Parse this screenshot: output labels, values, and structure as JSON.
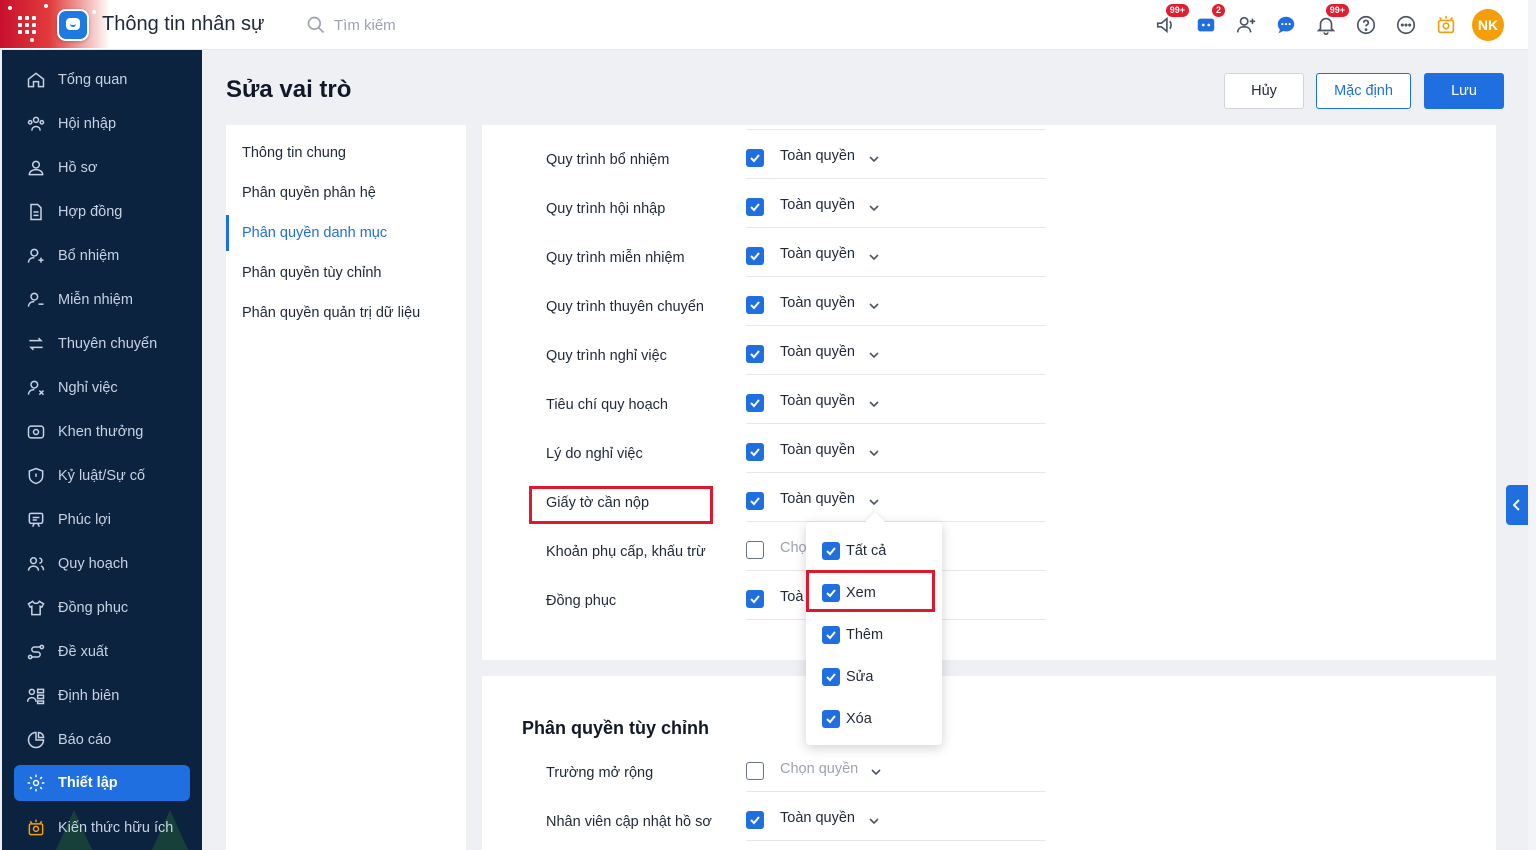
{
  "app": {
    "title": "Thông tin nhân sự",
    "search_placeholder": "Tìm kiếm"
  },
  "topbar": {
    "icons": [
      {
        "name": "megaphone-icon",
        "badge": "99+"
      },
      {
        "name": "cart-icon",
        "badge": "2"
      },
      {
        "name": "add-user-icon",
        "badge": ""
      },
      {
        "name": "chat-icon",
        "badge": ""
      },
      {
        "name": "bell-icon",
        "badge": "99+"
      },
      {
        "name": "help-icon",
        "badge": ""
      },
      {
        "name": "more-icon",
        "badge": ""
      },
      {
        "name": "idea-icon",
        "badge": ""
      }
    ],
    "avatar": "NK"
  },
  "sidebar": {
    "items": [
      {
        "label": "Tổng quan",
        "icon": "home-icon"
      },
      {
        "label": "Hội nhập",
        "icon": "team-icon"
      },
      {
        "label": "Hồ sơ",
        "icon": "user-icon"
      },
      {
        "label": "Hợp đồng",
        "icon": "document-icon"
      },
      {
        "label": "Bổ nhiệm",
        "icon": "user-plus-icon"
      },
      {
        "label": "Miễn nhiệm",
        "icon": "user-minus-icon"
      },
      {
        "label": "Thuyên chuyển",
        "icon": "transfer-icon"
      },
      {
        "label": "Nghỉ việc",
        "icon": "user-x-icon"
      },
      {
        "label": "Khen thưởng",
        "icon": "award-icon"
      },
      {
        "label": "Kỷ luật/Sự cố",
        "icon": "shield-icon"
      },
      {
        "label": "Phúc lợi",
        "icon": "gift-icon"
      },
      {
        "label": "Quy hoạch",
        "icon": "users-icon"
      },
      {
        "label": "Đồng phục",
        "icon": "shirt-icon"
      },
      {
        "label": "Đề xuất",
        "icon": "route-icon"
      },
      {
        "label": "Định biên",
        "icon": "org-icon"
      },
      {
        "label": "Báo cáo",
        "icon": "pie-icon"
      },
      {
        "label": "Thiết lập",
        "icon": "gear-icon",
        "active": true
      },
      {
        "label": "Kiến thức hữu ích",
        "icon": "bulb-icon"
      }
    ]
  },
  "page": {
    "title": "Sửa vai trò",
    "buttons": {
      "cancel": "Hủy",
      "default": "Mặc định",
      "save": "Lưu"
    }
  },
  "tabs": [
    {
      "label": "Thông tin chung"
    },
    {
      "label": "Phân quyền phân hệ"
    },
    {
      "label": "Phân quyền danh mục",
      "active": true
    },
    {
      "label": "Phân quyền tùy chỉnh"
    },
    {
      "label": "Phân quyền quản trị dữ liệu"
    }
  ],
  "category_rows": [
    {
      "label": "Quy trình bổ nhiệm",
      "checked": true,
      "value": "Toàn quyền"
    },
    {
      "label": "Quy trình hội nhập",
      "checked": true,
      "value": "Toàn quyền"
    },
    {
      "label": "Quy trình miễn nhiệm",
      "checked": true,
      "value": "Toàn quyền"
    },
    {
      "label": "Quy trình thuyên chuyển",
      "checked": true,
      "value": "Toàn quyền"
    },
    {
      "label": "Quy trình nghỉ việc",
      "checked": true,
      "value": "Toàn quyền"
    },
    {
      "label": "Tiêu chí quy hoạch",
      "checked": true,
      "value": "Toàn quyền"
    },
    {
      "label": "Lý do nghỉ việc",
      "checked": true,
      "value": "Toàn quyền"
    },
    {
      "label": "Giấy tờ cần nộp",
      "checked": true,
      "value": "Toàn quyền"
    },
    {
      "label": "Khoản phụ cấp, khấu trừ",
      "checked": false,
      "value": "Chọ"
    },
    {
      "label": "Đồng phục",
      "checked": true,
      "value": "Toà"
    }
  ],
  "custom_section": {
    "title": "Phân quyền tùy chỉnh",
    "rows": [
      {
        "label": "Trường mở rộng",
        "checked": false,
        "value": "Chọn quyền"
      },
      {
        "label": "Nhân viên cập nhật hồ sơ",
        "checked": true,
        "value": "Toàn quyền"
      }
    ]
  },
  "dropdown": {
    "options": [
      {
        "label": "Tất cả",
        "checked": true
      },
      {
        "label": "Xem",
        "checked": true
      },
      {
        "label": "Thêm",
        "checked": true
      },
      {
        "label": "Sửa",
        "checked": true
      },
      {
        "label": "Xóa",
        "checked": true
      }
    ]
  },
  "colors": {
    "primary": "#1f6fe0",
    "sidebar_bg": "#0c2340",
    "highlight": "#e0182d"
  }
}
